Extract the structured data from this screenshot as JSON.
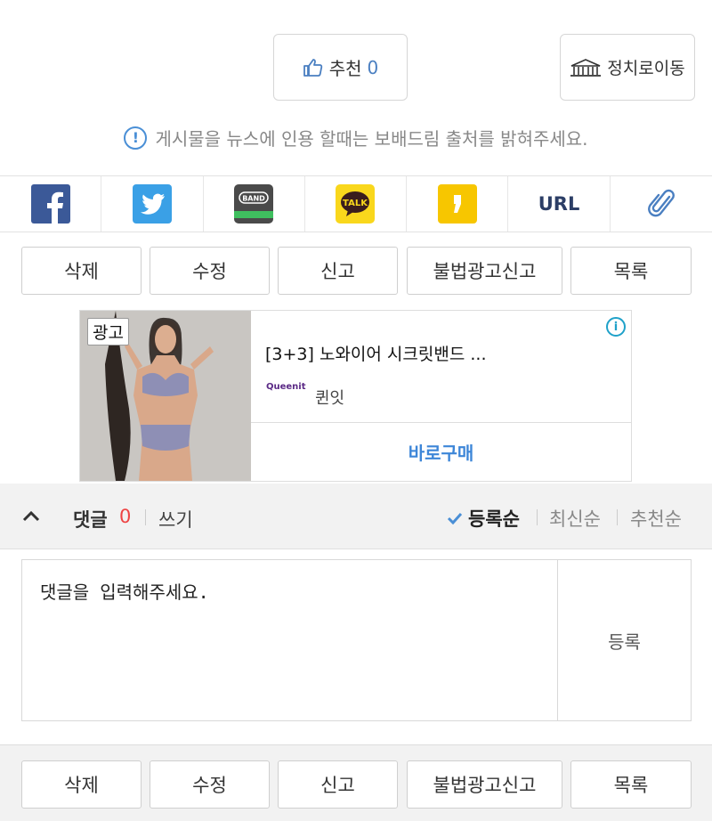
{
  "recommend": {
    "label": "추천",
    "count": "0"
  },
  "politics_button": {
    "label": "정치로이동"
  },
  "notice": "게시물을 뉴스에 인용 할때는 보배드림 출처를 밝혀주세요.",
  "share": {
    "items": [
      "facebook-icon",
      "twitter-icon",
      "band-icon",
      "kakaotalk-icon",
      "kakaostory-icon",
      "url",
      "clip-icon"
    ],
    "band_label": "BAND",
    "talk_label": "TALK",
    "url_label": "URL"
  },
  "actions_top": {
    "delete": "삭제",
    "edit": "수정",
    "report": "신고",
    "ad_report": "불법광고신고",
    "list": "목록"
  },
  "ad": {
    "badge": "광고",
    "title": "[3+3] 노와이어 시크릿밴드 ...",
    "brand_logo": "Queenit",
    "brand": "퀸잇",
    "cta": "바로구매",
    "info": "i"
  },
  "comments": {
    "title": "댓글",
    "count": "0",
    "write": "쓰기",
    "sort": {
      "registered": "등록순",
      "latest": "최신순",
      "recommended": "추천순"
    },
    "placeholder": "댓글을 입력해주세요.",
    "submit": "등록"
  },
  "actions_bottom": {
    "delete": "삭제",
    "edit": "수정",
    "report": "신고",
    "ad_report": "불법광고신고",
    "list": "목록"
  },
  "colors": {
    "accent_blue": "#4a7fc1",
    "count_red": "#e44",
    "cta_blue": "#3d86d8"
  }
}
